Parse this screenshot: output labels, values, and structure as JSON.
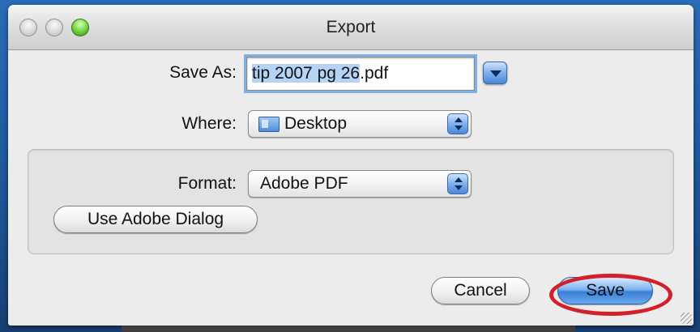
{
  "window": {
    "title": "Export"
  },
  "save_as": {
    "label": "Save As:",
    "value_selected": "tip 2007 pg 26",
    "value_rest": ".pdf"
  },
  "where": {
    "label": "Where:",
    "value": "Desktop",
    "icon": "desktop-folder-icon"
  },
  "format": {
    "label": "Format:",
    "value": "Adobe PDF"
  },
  "buttons": {
    "use_adobe_dialog": "Use Adobe Dialog",
    "cancel": "Cancel",
    "save": "Save"
  },
  "colors": {
    "annotation_ring": "#d3202a",
    "default_button": "#3b7fd6",
    "selection": "#b5d3f5"
  }
}
